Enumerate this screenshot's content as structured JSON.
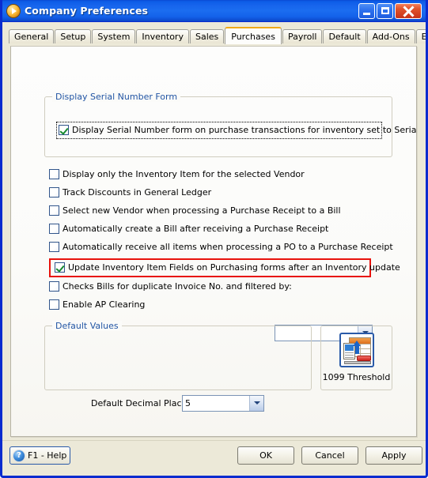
{
  "window": {
    "title": "Company Preferences",
    "icon": "orange-play-circle-icon",
    "controls": {
      "minimize": "Minimize",
      "maximize": "Maximize",
      "close": "Close"
    }
  },
  "tabs": [
    {
      "label": "General",
      "active": false
    },
    {
      "label": "Setup",
      "active": false
    },
    {
      "label": "System",
      "active": false
    },
    {
      "label": "Inventory",
      "active": false
    },
    {
      "label": "Sales",
      "active": false
    },
    {
      "label": "Purchases",
      "active": true
    },
    {
      "label": "Payroll",
      "active": false
    },
    {
      "label": "Default",
      "active": false
    },
    {
      "label": "Add-Ons",
      "active": false
    },
    {
      "label": "Email Setup",
      "active": false
    }
  ],
  "serial_group": {
    "title": "Display Serial Number Form",
    "checkbox": {
      "label": "Display Serial Number form on purchase transactions for inventory set to Serialized",
      "checked": true
    }
  },
  "options": [
    {
      "label": "Display only the Inventory Item for the selected Vendor",
      "checked": false
    },
    {
      "label": "Track Discounts in General Ledger",
      "checked": false
    },
    {
      "label": "Select new Vendor when processing a Purchase Receipt to a Bill",
      "checked": false
    },
    {
      "label": "Automatically create a Bill after receiving a Purchase Receipt",
      "checked": false
    },
    {
      "label": "Automatically receive all items when processing a PO to a Purchase Receipt",
      "checked": false
    },
    {
      "label": "Update Inventory Item Fields on Purchasing forms after an Inventory update",
      "checked": true
    },
    {
      "label": "Checks Bills for duplicate Invoice No. and filtered by:",
      "checked": false
    },
    {
      "label": "Enable AP Clearing",
      "checked": false
    }
  ],
  "invoice_filter_combo": {
    "value": "",
    "placeholder": ""
  },
  "defaults_group": {
    "title": "Default Values",
    "decimal_places_label": "Default Decimal Places",
    "decimal_places_value": "5"
  },
  "threshold_button": {
    "label": "1099 Threshold",
    "icon": "form-import-icon"
  },
  "footer": {
    "help": "F1 - Help",
    "ok": "OK",
    "cancel": "Cancel",
    "apply": "Apply"
  },
  "colors": {
    "titlebar_blue": "#1664ec",
    "group_title_blue": "#2255a4",
    "highlight_red": "#e8120c",
    "active_tab_accent": "#f0a818",
    "check_green": "#158a2e"
  }
}
